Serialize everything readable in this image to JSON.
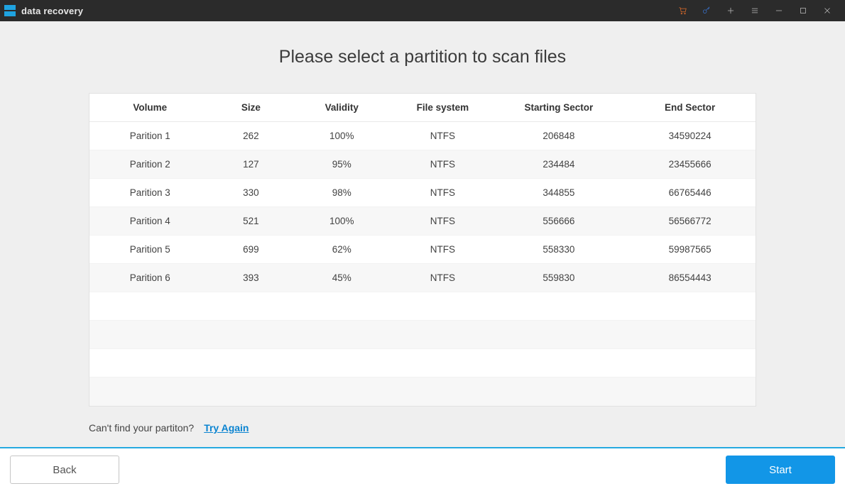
{
  "app": {
    "title": "data recovery"
  },
  "page": {
    "heading": "Please select a partition to scan files",
    "cant_find": "Can't find your partiton?",
    "try_again": "Try Again"
  },
  "table": {
    "headers": {
      "volume": "Volume",
      "size": "Size",
      "validity": "Validity",
      "fs": "File system",
      "start": "Starting Sector",
      "end": "End Sector"
    },
    "rows": [
      {
        "volume": "Parition 1",
        "size": "262",
        "validity": "100%",
        "fs": "NTFS",
        "start": "206848",
        "end": "34590224"
      },
      {
        "volume": "Parition 2",
        "size": "127",
        "validity": "95%",
        "fs": "NTFS",
        "start": "234484",
        "end": "23455666"
      },
      {
        "volume": "Parition 3",
        "size": "330",
        "validity": "98%",
        "fs": "NTFS",
        "start": "344855",
        "end": "66765446"
      },
      {
        "volume": "Parition 4",
        "size": "521",
        "validity": "100%",
        "fs": "NTFS",
        "start": "556666",
        "end": "56566772"
      },
      {
        "volume": "Parition 5",
        "size": "699",
        "validity": "62%",
        "fs": "NTFS",
        "start": "558330",
        "end": "59987565"
      },
      {
        "volume": "Parition 6",
        "size": "393",
        "validity": "45%",
        "fs": "NTFS",
        "start": "559830",
        "end": "86554443"
      }
    ]
  },
  "footer": {
    "back": "Back",
    "start": "Start"
  },
  "colors": {
    "accent": "#1296e7",
    "cart": "#e06c2b",
    "key": "#3a74d1"
  }
}
